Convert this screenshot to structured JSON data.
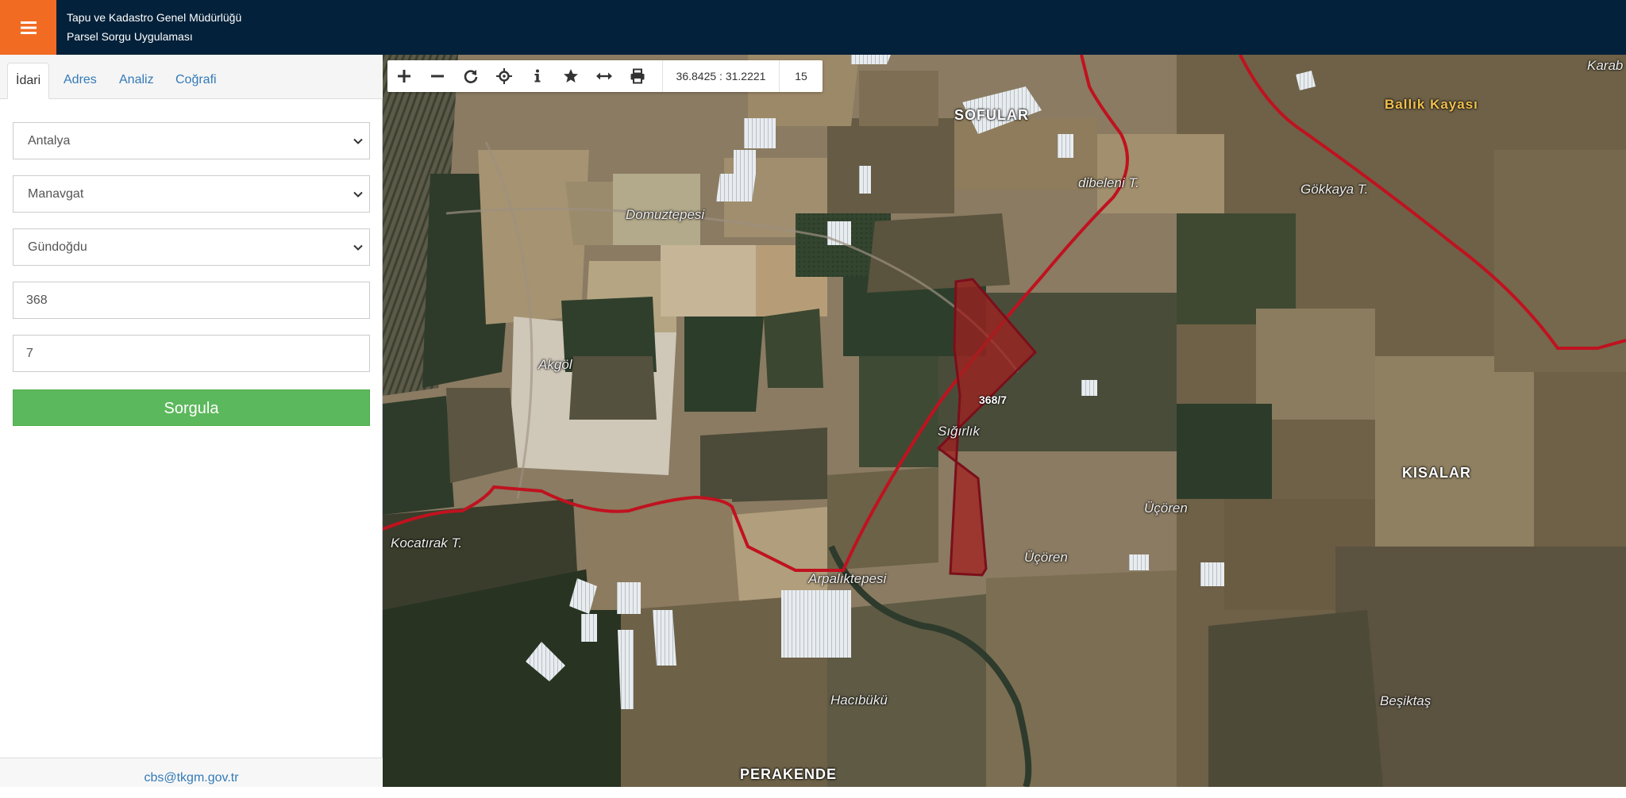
{
  "header": {
    "title_line1": "Tapu ve Kadastro Genel Müdürlüğü",
    "title_line2": "Parsel Sorgu Uygulaması"
  },
  "sidebar": {
    "tabs": [
      {
        "label": "İdari",
        "active": true
      },
      {
        "label": "Adres",
        "active": false
      },
      {
        "label": "Analiz",
        "active": false
      },
      {
        "label": "Coğrafi",
        "active": false
      }
    ],
    "province": "Antalya",
    "district": "Manavgat",
    "neighborhood": "Gündoğdu",
    "block_no": "368",
    "parcel_no": "7",
    "submit_label": "Sorgula",
    "footer_email": "cbs@tkgm.gov.tr"
  },
  "toolbar": {
    "tools": [
      "zoom-in-icon",
      "zoom-out-icon",
      "refresh-icon",
      "locate-icon",
      "info-icon",
      "favorite-icon",
      "measure-icon",
      "print-icon"
    ],
    "coordinates": "36.8425 : 31.2221",
    "zoom_level": "15"
  },
  "map": {
    "parcel_label": "368/7",
    "places": {
      "sofular": "SOFULAR",
      "ballik": "Ballık Kayası",
      "karab": "Karab",
      "gokkaya": "Gökkaya T.",
      "dibeleni": "dibeleni T.",
      "domuztepesi": "Domuztepesi",
      "akgol": "Akgöl",
      "sigirlik": "Sığırlık",
      "kisalar": "KISALAR",
      "ucoren1": "Üçören",
      "ucoren2": "Üçören",
      "kocatirak": "Kocatırak T.",
      "arpalik": "Arpalıktepesi",
      "hacibuku": "Hacıbükü",
      "besiktas": "Beşiktaş",
      "perakende": "PERAKENDE"
    },
    "colors": {
      "boundary": "#c0121f",
      "parcel_fill": "#a0201f",
      "header_bg": "#03213a",
      "menu_accent": "#f26b22",
      "button_green": "#5cb85c"
    }
  }
}
